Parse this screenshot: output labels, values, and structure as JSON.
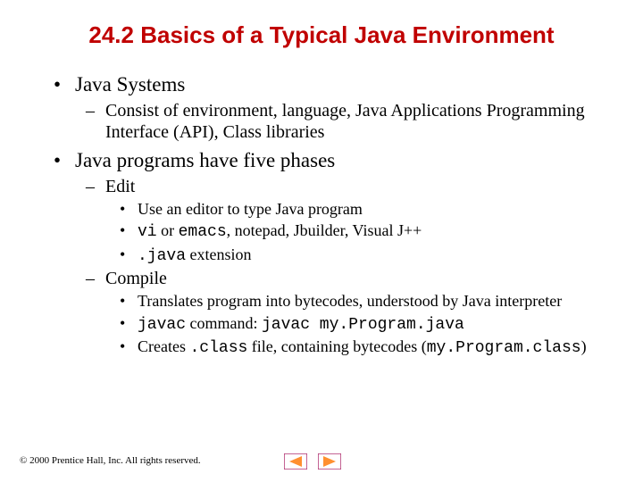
{
  "title": "24.2  Basics of a Typical Java Environment",
  "b1": "Java Systems",
  "b1a": "Consist of environment, language, Java Applications Programming Interface (API), Class libraries",
  "b2": "Java programs have five phases",
  "b2a": "Edit",
  "b2a1_pre": "Use an editor to type Java program",
  "b2a2_code1": "vi",
  "b2a2_mid": " or ",
  "b2a2_code2": "emacs",
  "b2a2_rest": ", notepad, Jbuilder, Visual J++",
  "b2a3_code": ".java",
  "b2a3_rest": " extension",
  "b2b": "Compile",
  "b2b1": "Translates program into bytecodes, understood by Java interpreter",
  "b2b2_code1": "javac",
  "b2b2_mid": " command:  ",
  "b2b2_code2": "javac my.Program.java",
  "b2b3_pre": "Creates ",
  "b2b3_code1": ".class",
  "b2b3_mid": " file, containing bytecodes (",
  "b2b3_code2": "my.Program.class",
  "b2b3_post": ")",
  "footer": "© 2000 Prentice Hall, Inc.  All rights reserved."
}
